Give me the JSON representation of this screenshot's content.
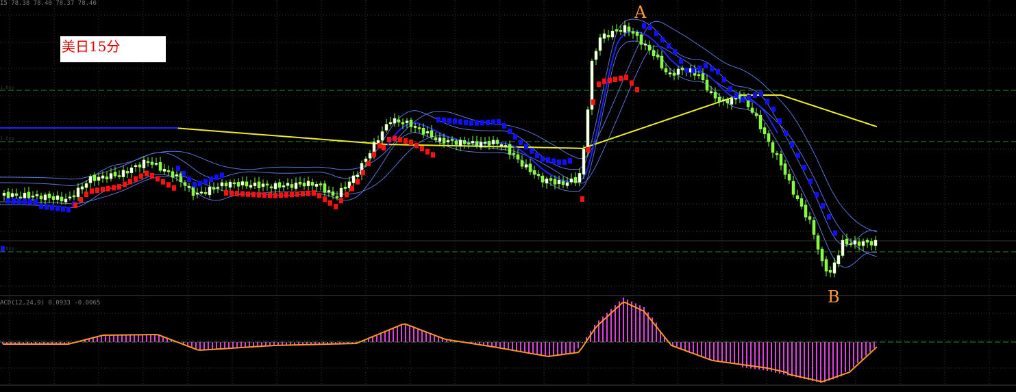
{
  "header": {
    "ohlc_text": "I5  78.38 78.40 78.37 78.40"
  },
  "overlay": {
    "label": "美日15分"
  },
  "annotations": {
    "peak": "A",
    "trough": "B"
  },
  "indicator": {
    "macd_text": "ACD(12,24,9) 0.0933 -0.0065"
  },
  "levels": {
    "upper": "1.buy",
    "mid": "1.buy",
    "lower": "1.buy"
  },
  "colors": {
    "bull": "#b8ff6a",
    "bull_fill": "#ffffff",
    "bear": "#7dff3a",
    "band_thin": "#5a74d8",
    "ma_blue": "#1e22ff",
    "ma_yellow": "#f0f020",
    "psar_red": "#ff1010",
    "psar_blue": "#1010ff",
    "macd_hist": "#e040e0",
    "macd_signal": "#ff9a1f",
    "hline": "#2d8f2d",
    "grid": "#3a3a3a"
  }
}
